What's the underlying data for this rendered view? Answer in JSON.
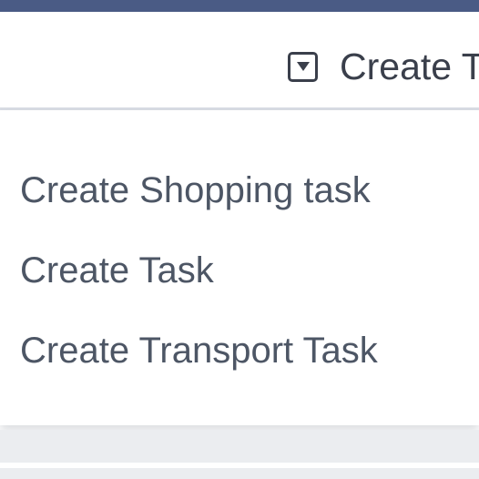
{
  "toolbar": {
    "create_label": "Create T",
    "dropdown_icon": "caret-down-box-icon"
  },
  "menu": {
    "items": [
      {
        "label": "Create Shopping task"
      },
      {
        "label": "Create Task"
      },
      {
        "label": "Create Transport Task"
      }
    ]
  },
  "colors": {
    "top_bar": "#4a5b85",
    "text_dark": "#3a3f4b",
    "text_menu": "#4d5665",
    "divider": "#d9dde4",
    "background_gray": "#ebedf0"
  }
}
